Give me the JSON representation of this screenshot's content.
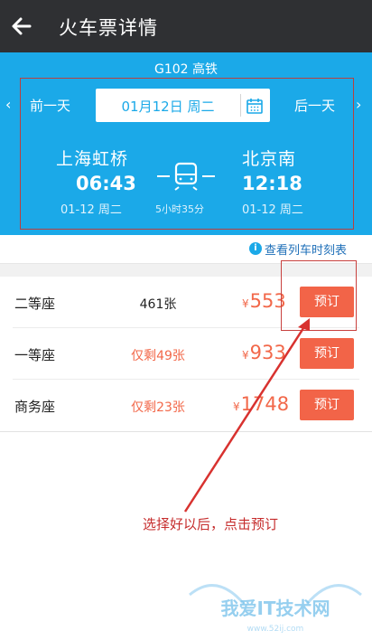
{
  "header": {
    "title": "火车票详情",
    "back_icon": "arrow-left-icon"
  },
  "train": {
    "number": "G102 高铁",
    "prev_day": "前一天",
    "next_day": "后一天",
    "date": "01月12日 周二",
    "from": {
      "station": "上海虹桥",
      "time": "06:43",
      "date": "01-12 周二"
    },
    "to": {
      "station": "北京南",
      "time": "12:18",
      "date": "01-12 周二"
    },
    "duration": "5小时35分"
  },
  "schedule_link": "查看列车时刻表",
  "seats": [
    {
      "name": "二等座",
      "availability": "461张",
      "price": "553",
      "button": "预订",
      "limited": false
    },
    {
      "name": "一等座",
      "availability": "仅剩49张",
      "price": "933",
      "button": "预订",
      "limited": true
    },
    {
      "name": "商务座",
      "availability": "仅剩23张",
      "price": "1748",
      "button": "预订",
      "limited": true
    }
  ],
  "currency_symbol": "¥",
  "annotation": "选择好以后，点击预订",
  "watermark": {
    "text": "我爱IT技术网",
    "url": "www.52ij.com"
  },
  "colors": {
    "accent": "#1ba9e8",
    "button": "#f26448",
    "price": "#f2684a",
    "annotation": "#c62d2d"
  }
}
